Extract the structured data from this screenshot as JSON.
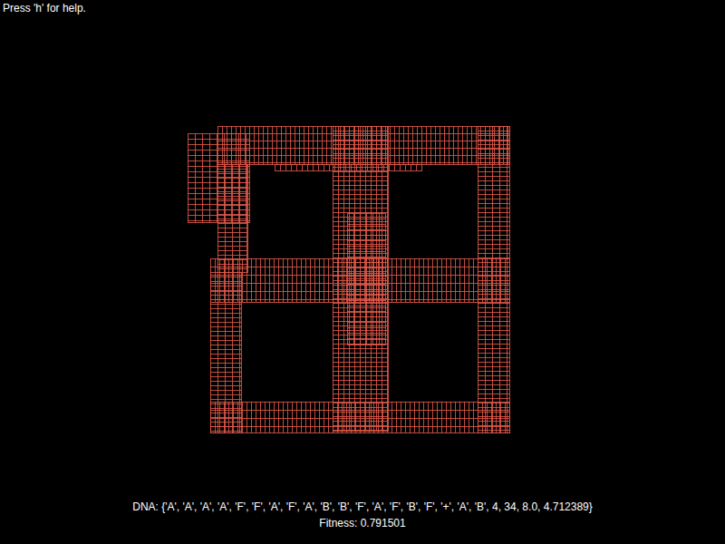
{
  "help_hint": "Press 'h' for help.",
  "dna": "DNA: {'A', 'A', 'A', 'A', 'F', 'F', 'A', 'F', 'A', 'B', 'B', 'F', 'A', 'F', 'B', 'F', '+', 'A', 'B', 4, 34, 8.0, 4.712389}",
  "fitness": "Fitness: 0.791501"
}
